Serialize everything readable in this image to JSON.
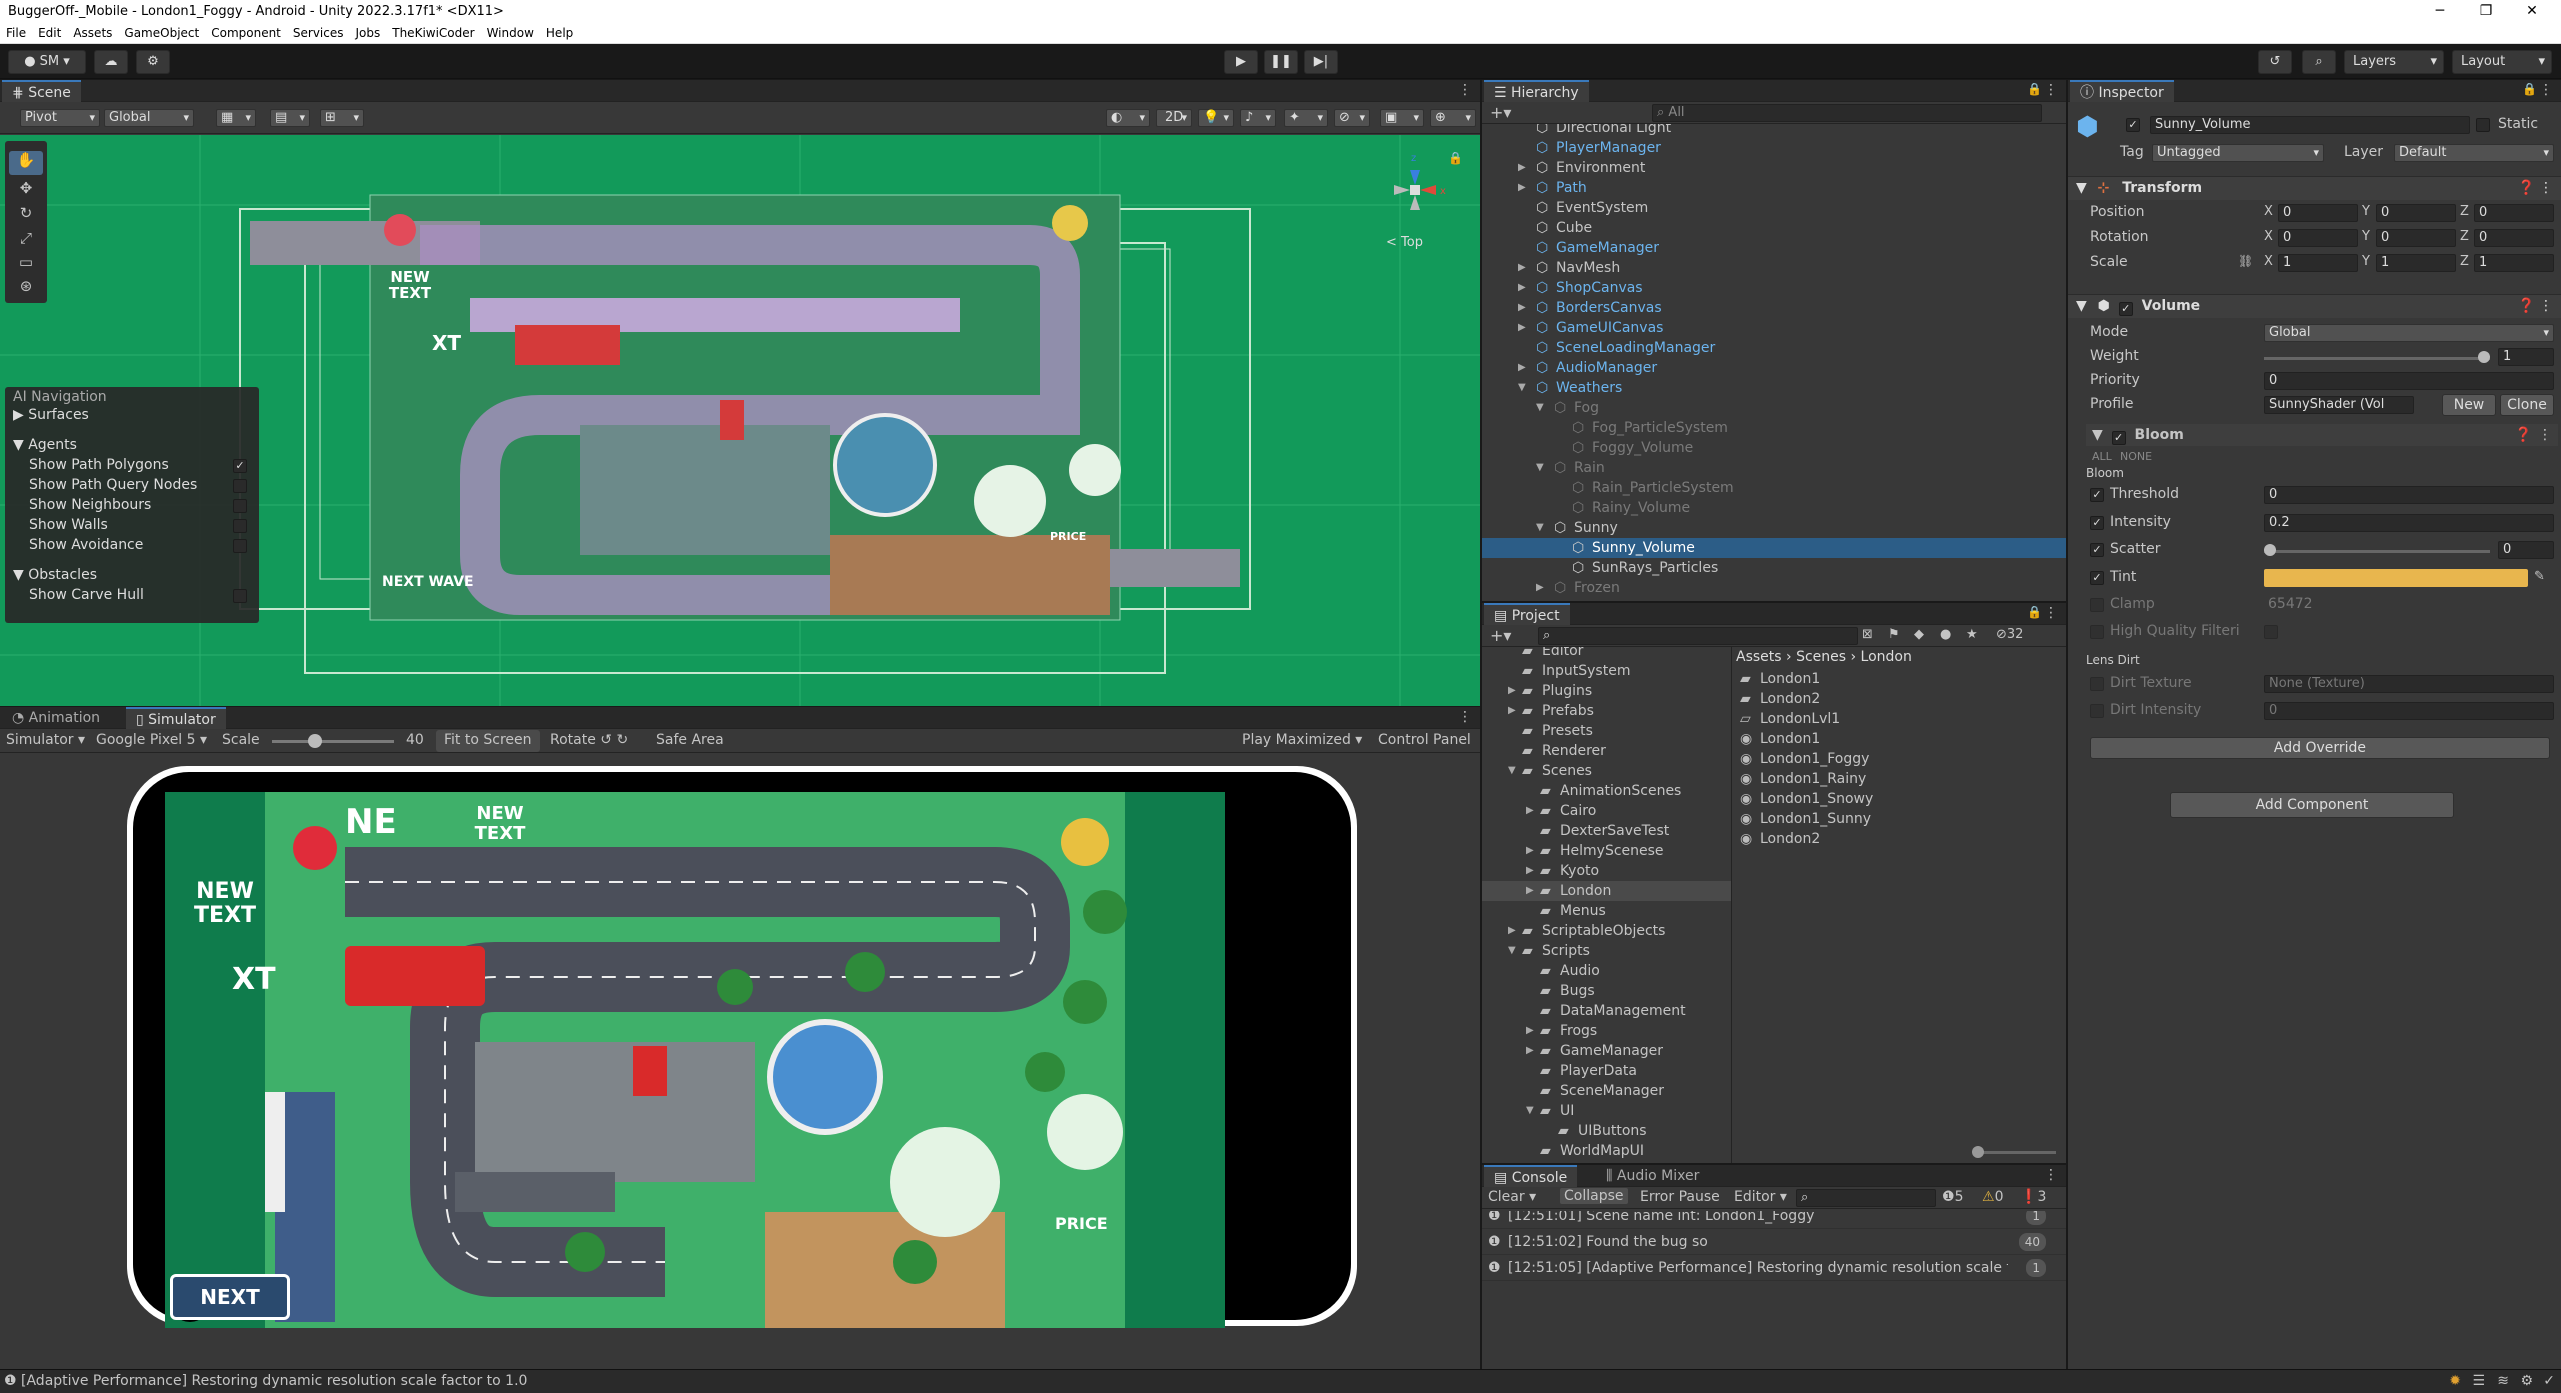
{
  "window": {
    "title": "BuggerOff-_Mobile - London1_Foggy - Android - Unity 2022.3.17f1* <DX11>"
  },
  "menu": [
    "File",
    "Edit",
    "Assets",
    "GameObject",
    "Component",
    "Services",
    "Jobs",
    "TheKiwiCoder",
    "Window",
    "Help"
  ],
  "toolbar": {
    "account": "SM",
    "layers": "Layers",
    "layout": "Layout"
  },
  "scene": {
    "tab": "Scene",
    "pivot": "Pivot",
    "global": "Global",
    "mode2d": "2D",
    "gizmo_label": "< Top",
    "nav": {
      "title": "AI Navigation",
      "surfaces": "Surfaces",
      "agents": "Agents",
      "obstacles": "Obstacles",
      "items": [
        {
          "label": "Show Path Polygons",
          "checked": true
        },
        {
          "label": "Show Path Query Nodes",
          "checked": false
        },
        {
          "label": "Show Neighbours",
          "checked": false
        },
        {
          "label": "Show Walls",
          "checked": false
        },
        {
          "label": "Show Avoidance",
          "checked": false
        }
      ],
      "carve": "Show Carve Hull"
    },
    "overlay_texts": [
      "NEW TEXT",
      "XT",
      "NEXT WAVE",
      "PRICE"
    ]
  },
  "simulator": {
    "tab_animation": "Animation",
    "tab_simulator": "Simulator",
    "mode": "Simulator",
    "device": "Google Pixel 5",
    "scale_label": "Scale",
    "scale_value": "40",
    "fit": "Fit to Screen",
    "rotate": "Rotate",
    "safe_area": "Safe Area",
    "play": "Play Maximized",
    "control": "Control Panel",
    "game_texts": {
      "ne": "NE",
      "new_text": "NEW TEXT",
      "new_text2": "NEW TEXT",
      "xt": "XT",
      "next_wave": "NEXT WAVE",
      "price": "PRICE"
    }
  },
  "hierarchy": {
    "tab": "Hierarchy",
    "search": "All",
    "items": [
      {
        "label": "Directional Light",
        "indent": 1,
        "color": "normal",
        "arrow": ""
      },
      {
        "label": "PlayerManager",
        "indent": 1,
        "color": "blue",
        "arrow": ""
      },
      {
        "label": "Environment",
        "indent": 1,
        "color": "normal",
        "arrow": "▶"
      },
      {
        "label": "Path",
        "indent": 1,
        "color": "blue",
        "arrow": "▶"
      },
      {
        "label": "EventSystem",
        "indent": 1,
        "color": "normal",
        "arrow": ""
      },
      {
        "label": "Cube",
        "indent": 1,
        "color": "normal",
        "arrow": ""
      },
      {
        "label": "GameManager",
        "indent": 1,
        "color": "blue",
        "arrow": ""
      },
      {
        "label": "NavMesh",
        "indent": 1,
        "color": "normal",
        "arrow": "▶"
      },
      {
        "label": "ShopCanvas",
        "indent": 1,
        "color": "blue",
        "arrow": "▶"
      },
      {
        "label": "BordersCanvas",
        "indent": 1,
        "color": "blue",
        "arrow": "▶"
      },
      {
        "label": "GameUICanvas",
        "indent": 1,
        "color": "blue",
        "arrow": "▶"
      },
      {
        "label": "SceneLoadingManager",
        "indent": 1,
        "color": "blue",
        "arrow": ""
      },
      {
        "label": "AudioManager",
        "indent": 1,
        "color": "blue",
        "arrow": "▶"
      },
      {
        "label": "Weathers",
        "indent": 1,
        "color": "blue",
        "arrow": "▼"
      },
      {
        "label": "Fog",
        "indent": 2,
        "color": "gray",
        "arrow": "▼"
      },
      {
        "label": "Fog_ParticleSystem",
        "indent": 3,
        "color": "gray",
        "arrow": ""
      },
      {
        "label": "Foggy_Volume",
        "indent": 3,
        "color": "gray",
        "arrow": ""
      },
      {
        "label": "Rain",
        "indent": 2,
        "color": "gray",
        "arrow": "▼"
      },
      {
        "label": "Rain_ParticleSystem",
        "indent": 3,
        "color": "gray",
        "arrow": ""
      },
      {
        "label": "Rainy_Volume",
        "indent": 3,
        "color": "gray",
        "arrow": ""
      },
      {
        "label": "Sunny",
        "indent": 2,
        "color": "normal",
        "arrow": "▼"
      },
      {
        "label": "Sunny_Volume",
        "indent": 3,
        "color": "normal",
        "arrow": "",
        "selected": true
      },
      {
        "label": "SunRays_Particles",
        "indent": 3,
        "color": "normal",
        "arrow": ""
      },
      {
        "label": "Frozen",
        "indent": 2,
        "color": "gray",
        "arrow": "▶"
      }
    ]
  },
  "project": {
    "tab": "Project",
    "hidden_count": "32",
    "breadcrumb": [
      "Assets",
      "Scenes",
      "London"
    ],
    "tree": [
      {
        "label": "Editor",
        "indent": 1,
        "arrow": ""
      },
      {
        "label": "InputSystem",
        "indent": 1,
        "arrow": ""
      },
      {
        "label": "Plugins",
        "indent": 1,
        "arrow": "▶"
      },
      {
        "label": "Prefabs",
        "indent": 1,
        "arrow": "▶"
      },
      {
        "label": "Presets",
        "indent": 1,
        "arrow": ""
      },
      {
        "label": "Renderer",
        "indent": 1,
        "arrow": ""
      },
      {
        "label": "Scenes",
        "indent": 1,
        "arrow": "▼"
      },
      {
        "label": "AnimationScenes",
        "indent": 2,
        "arrow": ""
      },
      {
        "label": "Cairo",
        "indent": 2,
        "arrow": "▶"
      },
      {
        "label": "DexterSaveTest",
        "indent": 2,
        "arrow": ""
      },
      {
        "label": "HelmyScenese",
        "indent": 2,
        "arrow": "▶"
      },
      {
        "label": "Kyoto",
        "indent": 2,
        "arrow": "▶"
      },
      {
        "label": "London",
        "indent": 2,
        "arrow": "▶",
        "selected": true
      },
      {
        "label": "Menus",
        "indent": 2,
        "arrow": ""
      },
      {
        "label": "ScriptableObjects",
        "indent": 1,
        "arrow": "▶"
      },
      {
        "label": "Scripts",
        "indent": 1,
        "arrow": "▼"
      },
      {
        "label": "Audio",
        "indent": 2,
        "arrow": ""
      },
      {
        "label": "Bugs",
        "indent": 2,
        "arrow": ""
      },
      {
        "label": "DataManagement",
        "indent": 2,
        "arrow": ""
      },
      {
        "label": "Frogs",
        "indent": 2,
        "arrow": "▶"
      },
      {
        "label": "GameManager",
        "indent": 2,
        "arrow": "▶"
      },
      {
        "label": "PlayerData",
        "indent": 2,
        "arrow": ""
      },
      {
        "label": "SceneManager",
        "indent": 2,
        "arrow": ""
      },
      {
        "label": "UI",
        "indent": 2,
        "arrow": "▼"
      },
      {
        "label": "UIButtons",
        "indent": 3,
        "arrow": ""
      },
      {
        "label": "WorldMapUI",
        "indent": 2,
        "arrow": ""
      }
    ],
    "files": [
      {
        "label": "London1",
        "type": "folder"
      },
      {
        "label": "London2",
        "type": "folder"
      },
      {
        "label": "LondonLvl1",
        "type": "folder-empty"
      },
      {
        "label": "London1",
        "type": "scene"
      },
      {
        "label": "London1_Foggy",
        "type": "scene"
      },
      {
        "label": "London1_Rainy",
        "type": "scene"
      },
      {
        "label": "London1_Snowy",
        "type": "scene"
      },
      {
        "label": "London1_Sunny",
        "type": "scene"
      },
      {
        "label": "London2",
        "type": "scene"
      }
    ]
  },
  "console": {
    "tab": "Console",
    "tab2": "Audio Mixer",
    "clear": "Clear",
    "collapse": "Collapse",
    "error_pause": "Error Pause",
    "editor": "Editor",
    "count_info": "5",
    "count_warn": "0",
    "count_err": "3",
    "messages": [
      {
        "text": "[12:51:01] Scene name int: London1_Foggy",
        "count": "1"
      },
      {
        "text": "[12:51:02] Found the bug so",
        "count": "40"
      },
      {
        "text": "[12:51:05] [Adaptive Performance] Restoring dynamic resolution scale f",
        "count": "1"
      }
    ]
  },
  "inspector": {
    "tab": "Inspector",
    "object_name": "Sunny_Volume",
    "static": "Static",
    "tag_label": "Tag",
    "tag": "Untagged",
    "layer_label": "Layer",
    "layer": "Default",
    "transform": {
      "title": "Transform",
      "rows": [
        {
          "label": "Position",
          "x": "0",
          "y": "0",
          "z": "0"
        },
        {
          "label": "Rotation",
          "x": "0",
          "y": "0",
          "z": "0"
        },
        {
          "label": "Scale",
          "x": "1",
          "y": "1",
          "z": "1"
        }
      ]
    },
    "volume": {
      "title": "Volume",
      "mode_label": "Mode",
      "mode": "Global",
      "weight_label": "Weight",
      "weight": "1",
      "priority_label": "Priority",
      "priority": "0",
      "profile_label": "Profile",
      "profile": "SunnyShader (Vol",
      "new": "New",
      "clone": "Clone"
    },
    "bloom": {
      "title": "Bloom",
      "all": "ALL",
      "none": "NONE",
      "sub": "Bloom",
      "threshold_label": "Threshold",
      "threshold": "0",
      "intensity_label": "Intensity",
      "intensity": "0.2",
      "scatter_label": "Scatter",
      "scatter": "0",
      "tint_label": "Tint",
      "tint_color": "#e8b64e",
      "clamp_label": "Clamp",
      "clamp": "65472",
      "hq_label": "High Quality Filteri",
      "lens_dirt": "Lens Dirt",
      "dirt_texture_label": "Dirt Texture",
      "dirt_texture": "None (Texture)",
      "dirt_intensity_label": "Dirt Intensity",
      "dirt_intensity": "0"
    },
    "add_override": "Add Override",
    "add_component": "Add Component"
  },
  "status": {
    "message": "[Adaptive Performance] Restoring dynamic resolution scale factor to 1.0"
  },
  "colors": {
    "selection": "#2c5d87",
    "accent": "#3a79bb",
    "scene_green": "#129a5a"
  }
}
